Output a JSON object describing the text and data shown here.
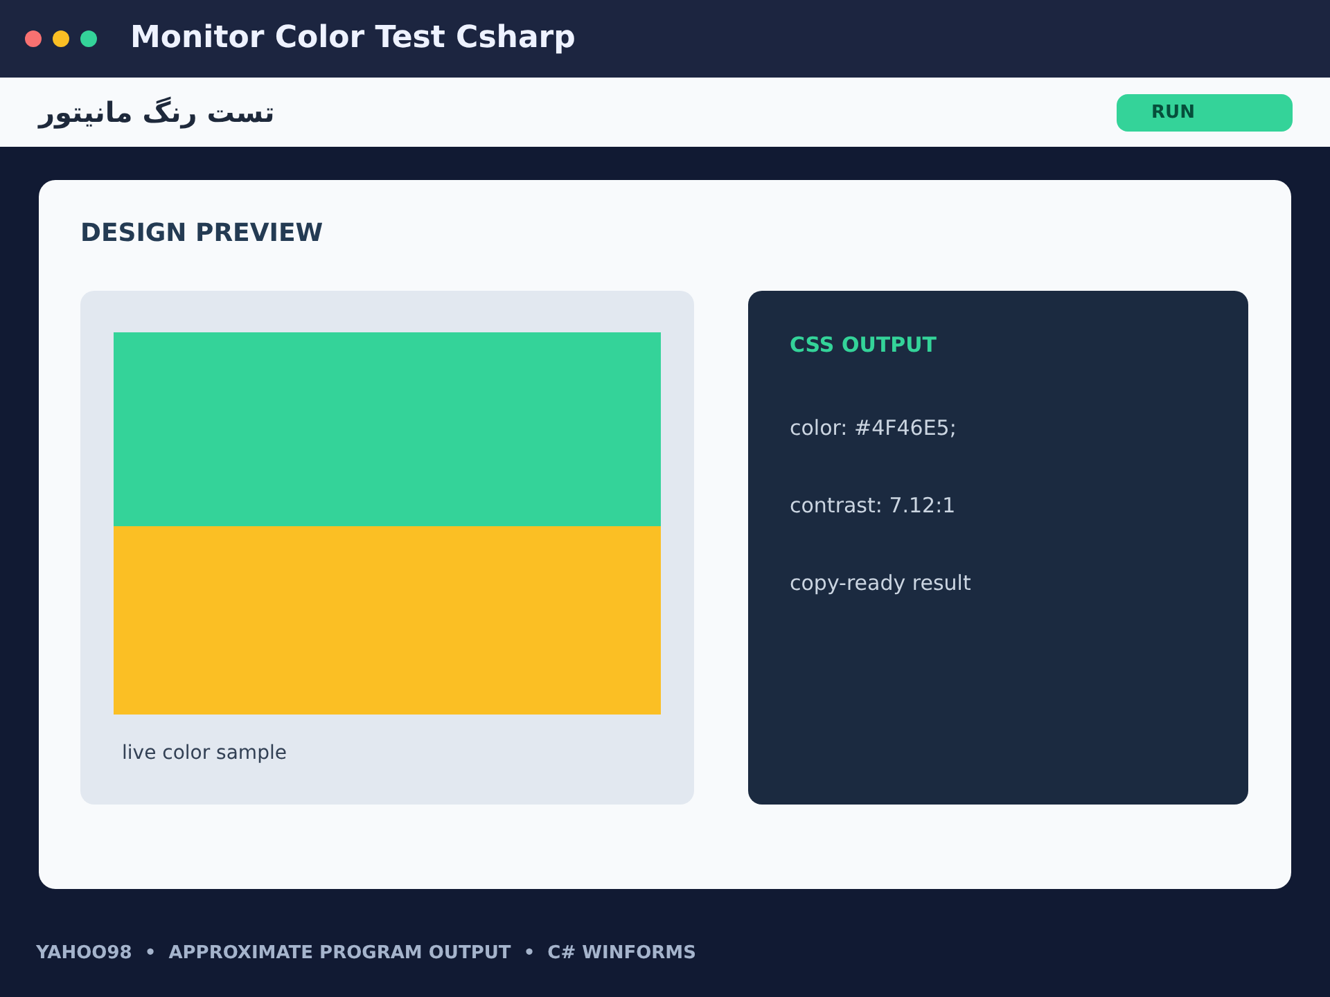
{
  "window": {
    "title": "Monitor Color Test Csharp",
    "controls": [
      {
        "color": "#f87171"
      },
      {
        "color": "#fbbf24"
      },
      {
        "color": "#34d399"
      }
    ]
  },
  "toolbar": {
    "title": "تست رنگ مانیتور",
    "button": "RUN"
  },
  "card": {
    "title": "DESIGN PREVIEW",
    "preview": {
      "bands": [
        {
          "color": "#34d399"
        },
        {
          "color": "#fbbf24"
        }
      ],
      "caption": "live color sample"
    },
    "output": {
      "title": "CSS OUTPUT",
      "lines": [
        "color: #4F46E5;",
        "contrast: 7.12:1",
        "copy-ready result"
      ]
    }
  },
  "footer": {
    "text": "YAHOO98  •  APPROXIMATE PROGRAM OUTPUT  •  C# WINFORMS"
  }
}
